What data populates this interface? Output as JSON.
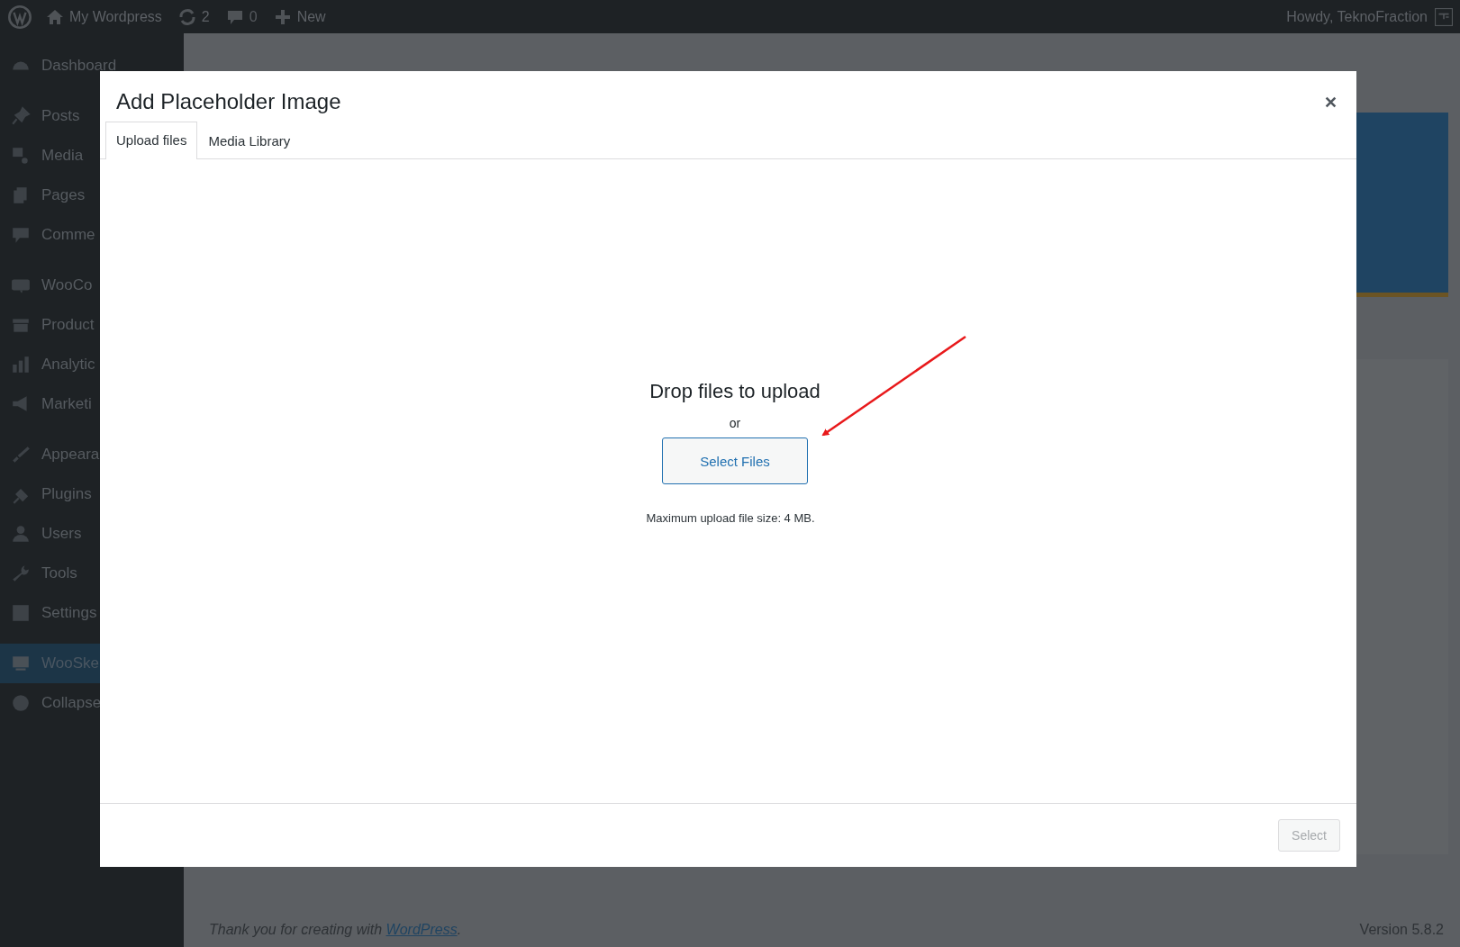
{
  "admin_bar": {
    "site": "My Wordpress",
    "updates": "2",
    "comments": "0",
    "new": "New",
    "greeting": "Howdy, TeknoFraction"
  },
  "sidebar": {
    "groups": [
      [
        {
          "label": "Dashboard",
          "selected": false
        }
      ],
      [
        {
          "label": "Posts",
          "selected": false
        },
        {
          "label": "Media",
          "selected": false
        },
        {
          "label": "Pages",
          "selected": false
        },
        {
          "label": "Comme",
          "selected": false
        }
      ],
      [
        {
          "label": "WooCo",
          "selected": false
        },
        {
          "label": "Product",
          "selected": false
        },
        {
          "label": "Analytic",
          "selected": false
        },
        {
          "label": "Marketi",
          "selected": false
        }
      ],
      [
        {
          "label": "Appeara",
          "selected": false
        },
        {
          "label": "Plugins",
          "selected": false
        },
        {
          "label": "Users",
          "selected": false
        },
        {
          "label": "Tools",
          "selected": false
        },
        {
          "label": "Settings",
          "selected": false
        }
      ],
      [
        {
          "label": "WooSke",
          "selected": true
        },
        {
          "label": "Collapse",
          "selected": false
        }
      ]
    ]
  },
  "modal": {
    "title": "Add Placeholder Image",
    "tabs": [
      {
        "label": "Upload files",
        "selected": true
      },
      {
        "label": "Media Library",
        "selected": false
      }
    ],
    "drop_text": "Drop files to upload",
    "or": "or",
    "select_files": "Select Files",
    "max_size": "Maximum upload file size: 4 MB.",
    "select_button": "Select",
    "select_disabled": true
  },
  "footer": {
    "text_before": "Thank you for creating with ",
    "link": "WordPress",
    "text_after": ".",
    "version": "Version 5.8.2"
  }
}
